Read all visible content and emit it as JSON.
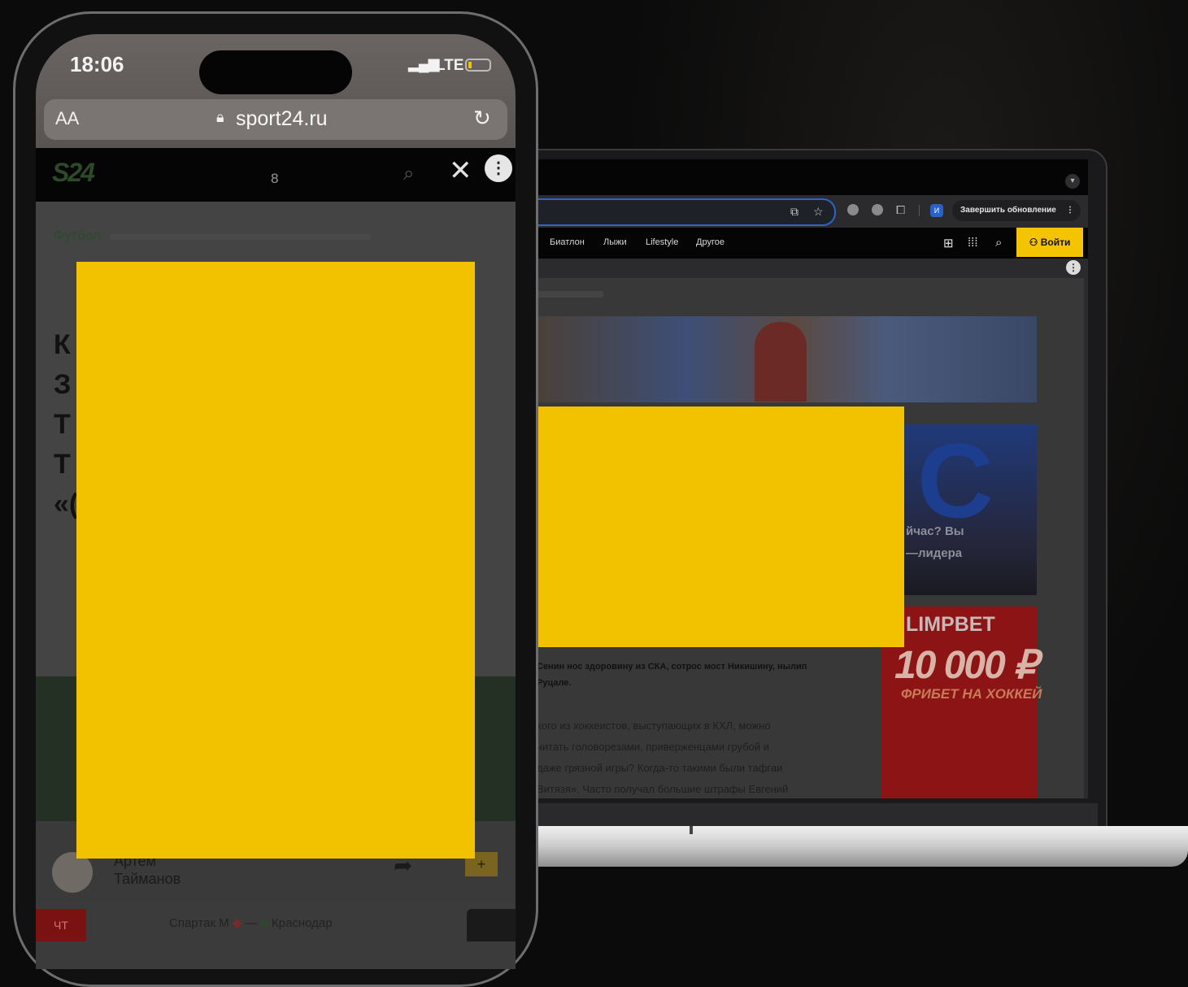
{
  "laptop": {
    "toolbar": {
      "update_label": "Завершить обновление",
      "update_menu": "⋮",
      "profile_initial": "И"
    },
    "nav": {
      "items": [
        "Биатлон",
        "Лыжи",
        "Lifestyle",
        "Другое"
      ],
      "login_label": "Войти"
    },
    "overlay_menu": "⋮",
    "article": {
      "promo_letter": "C",
      "promo_text_1": "йчас? Вы",
      "promo_text_2": "—лидера",
      "ad_brand": "LIMPBET",
      "ad_amount": "10 000 ₽",
      "ad_sub": "ФРИБЕТ НА ХОККЕЙ",
      "lead_1": "Сенин нос здоровину из СКА, сотрос мост Никишину, нылип",
      "lead_2": "Руцале.",
      "body": [
        "кого из хоккеистов, выступающих в КХЛ, можно",
        "читать головорезами, приверженцами грубой и",
        "даже грязной игры? Когда-то такими были тафгаи",
        "Витязя». Часто получал большие штрафы Евгений"
      ]
    }
  },
  "phone": {
    "status": {
      "time": "18:06",
      "network": "LTE",
      "signal": "▂▄▆"
    },
    "browser": {
      "text_size": "AA",
      "url": "sport24.ru"
    },
    "header": {
      "logo": "S24",
      "counter": "8"
    },
    "breadcrumb": "Футбол",
    "headline_lines": [
      "К",
      "З",
      "Т",
      "Т",
      "«("
    ],
    "author_first": "Артем",
    "author_last": "Тайманов",
    "plus_label": "+",
    "day_label": "ЧТ",
    "match_home": "Спартак М",
    "match_sep": "—",
    "match_away": "Краснодар"
  }
}
